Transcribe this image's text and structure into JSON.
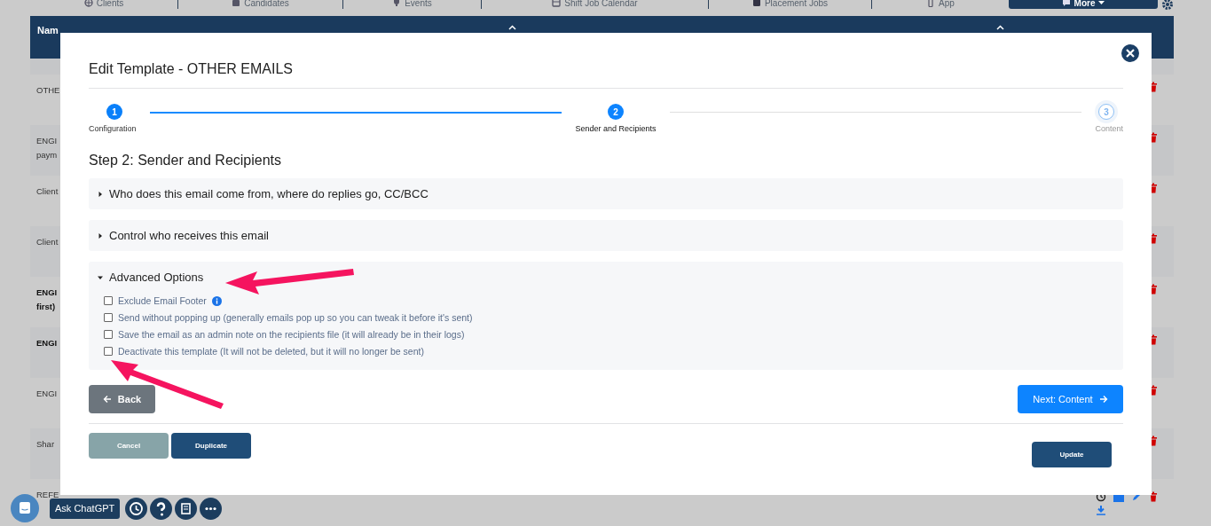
{
  "nav": {
    "tabs": [
      {
        "label": "Clients",
        "selected": false
      },
      {
        "label": "Candidates",
        "selected": false
      },
      {
        "label": "Events",
        "selected": false
      },
      {
        "label": "Shift Job Calendar",
        "selected": false
      },
      {
        "label": "Placement Jobs",
        "selected": false
      },
      {
        "label": "App",
        "selected": false
      },
      {
        "label": "More",
        "selected": true
      }
    ]
  },
  "table": {
    "columns": [
      "Nam"
    ],
    "rows": [
      {
        "lines": [
          "OTHE"
        ],
        "bold": false
      },
      {
        "lines": [
          "ENGI",
          "paym"
        ],
        "bold": false
      },
      {
        "lines": [
          "Client"
        ],
        "bold": false
      },
      {
        "lines": [
          "Client"
        ],
        "bold": false
      },
      {
        "lines": [
          "ENGI",
          "first)"
        ],
        "bold": true
      },
      {
        "lines": [
          "ENGI"
        ],
        "bold": true
      },
      {
        "lines": [
          "ENGI"
        ],
        "bold": false
      },
      {
        "lines": [
          "Shar"
        ],
        "bold": false
      },
      {
        "lines": [
          "REFE"
        ],
        "bold": false,
        "kind": "full"
      }
    ]
  },
  "modal": {
    "title": "Edit Template - OTHER EMAILS",
    "steps": [
      {
        "number": "1",
        "label": "Configuration",
        "completed": true,
        "selected": false
      },
      {
        "number": "2",
        "label": "Sender and Recipients",
        "completed": false,
        "selected": true
      },
      {
        "number": "3",
        "label": "Content",
        "completed": false,
        "selected": false
      }
    ],
    "heading": "Step 2: Sender and Recipients",
    "sections": [
      {
        "title": "Who does this email come from, where do replies go, CC/BCC",
        "expanded": false
      },
      {
        "title": "Control who receives this email",
        "expanded": false
      },
      {
        "title": "Advanced Options",
        "expanded": true,
        "options": [
          {
            "label": "Exclude Email Footer",
            "checked": false,
            "info": true
          },
          {
            "label": "Send without popping up (generally emails pop up so you can tweak it before it's sent)",
            "checked": false,
            "info": false
          },
          {
            "label": "Save the email as an admin note on the recipients file (it will already be in their logs)",
            "checked": false,
            "info": false
          },
          {
            "label": "Deactivate this template (It will not be deleted, but it will no longer be sent)",
            "checked": false,
            "info": false
          }
        ]
      }
    ],
    "back_button": "Back",
    "next_button": "Next: Content",
    "cancel_button": "Cancel",
    "duplicate_button": "Duplicate",
    "update_button": "Update"
  },
  "footer_tools": {
    "chat_button": "Ask ChatGPT"
  }
}
